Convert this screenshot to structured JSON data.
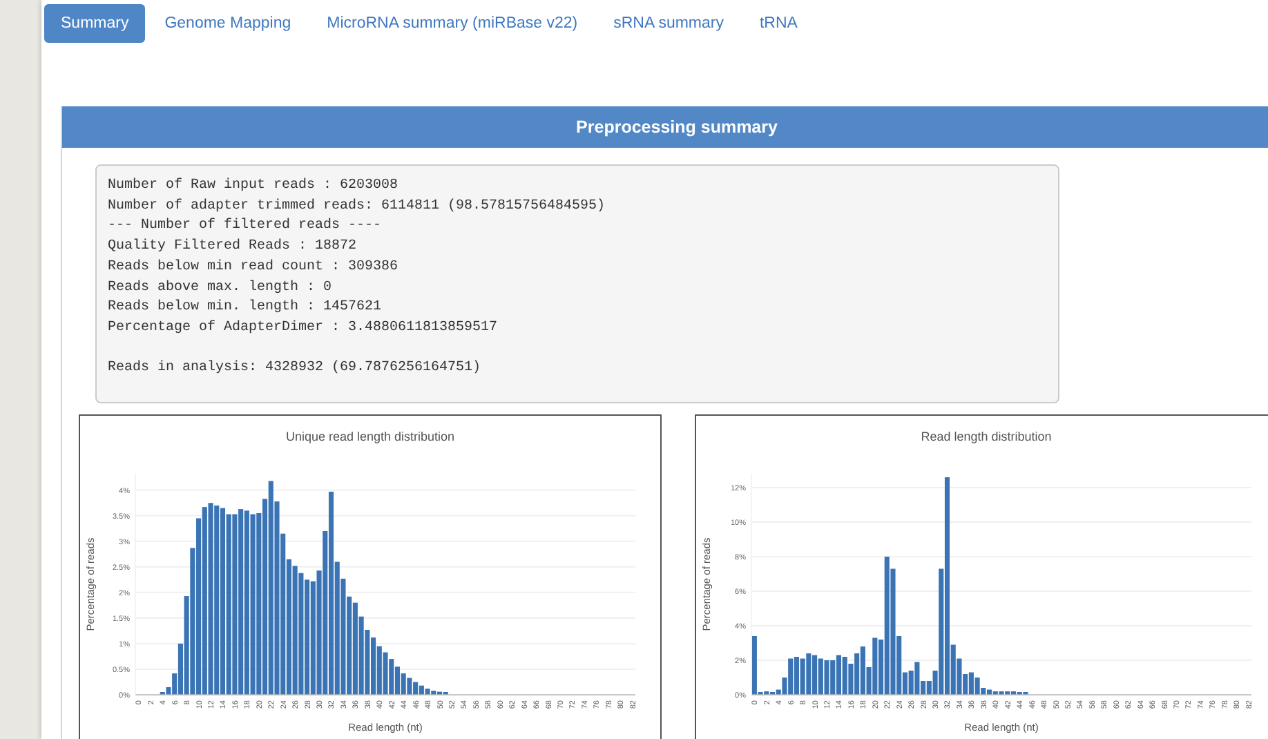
{
  "tabs": [
    {
      "label": "Summary",
      "selected": true
    },
    {
      "label": "Genome Mapping",
      "selected": false
    },
    {
      "label": "MicroRNA summary (miRBase v22)",
      "selected": false
    },
    {
      "label": "sRNA summary",
      "selected": false
    },
    {
      "label": "tRNA",
      "selected": false
    }
  ],
  "preprocessing": {
    "title": "Preprocessing summary",
    "lines": [
      "Number of Raw input reads : 6203008",
      "Number of adapter trimmed reads: 6114811 (98.57815756484595)",
      "--- Number of filtered reads ----",
      "Quality Filtered Reads : 18872",
      "Reads below min read count : 309386",
      "Reads above max. length : 0",
      "Reads below min. length : 1457621",
      "Percentage of AdapterDimer : 3.4880611813859517"
    ],
    "result": "Reads in analysis: 4328932 (69.7876256164751)"
  },
  "charts": [
    {
      "chart_data": {
        "type": "bar",
        "title": "Unique read length distribution",
        "xlabel": "Read length (nt)",
        "ylabel": "Percentage of reads",
        "x": [
          0,
          1,
          2,
          3,
          4,
          5,
          6,
          7,
          8,
          9,
          10,
          11,
          12,
          13,
          14,
          15,
          16,
          17,
          18,
          19,
          20,
          21,
          22,
          23,
          24,
          25,
          26,
          27,
          28,
          29,
          30,
          31,
          32,
          33,
          34,
          35,
          36,
          37,
          38,
          39,
          40,
          41,
          42,
          43,
          44,
          45,
          46,
          47,
          48,
          49,
          50,
          51,
          52,
          53,
          54,
          55,
          56,
          57,
          58,
          59,
          60,
          61,
          62,
          63,
          64,
          65,
          66,
          67,
          68,
          69,
          70,
          71,
          72,
          73,
          74,
          75,
          76,
          77,
          78,
          79,
          80,
          81,
          82
        ],
        "xlim": [
          -0.5,
          82.5
        ],
        "ylim": [
          0,
          4.32
        ],
        "grid": true,
        "values": [
          0,
          0,
          0,
          0,
          0.05,
          0.15,
          0.42,
          1.0,
          1.93,
          2.87,
          3.45,
          3.67,
          3.75,
          3.7,
          3.65,
          3.53,
          3.53,
          3.63,
          3.6,
          3.53,
          3.55,
          3.83,
          4.18,
          3.78,
          3.15,
          2.65,
          2.52,
          2.38,
          2.25,
          2.22,
          2.43,
          3.2,
          3.97,
          2.6,
          2.27,
          1.92,
          1.8,
          1.53,
          1.27,
          1.12,
          0.95,
          0.83,
          0.7,
          0.55,
          0.42,
          0.33,
          0.25,
          0.18,
          0.12,
          0.08,
          0.06,
          0.05,
          0,
          0,
          0,
          0,
          0,
          0,
          0,
          0,
          0,
          0,
          0,
          0,
          0,
          0,
          0,
          0,
          0,
          0,
          0,
          0,
          0,
          0,
          0,
          0,
          0,
          0,
          0,
          0,
          0,
          0,
          0
        ],
        "yticks": [
          {
            "value": 0,
            "label": "0%"
          },
          {
            "value": 0.5,
            "label": "0.5%"
          },
          {
            "value": 1,
            "label": "1%"
          },
          {
            "value": 1.5,
            "label": "1.5%"
          },
          {
            "value": 2,
            "label": "2%"
          },
          {
            "value": 2.5,
            "label": "2.5%"
          },
          {
            "value": 3,
            "label": "3%"
          },
          {
            "value": 3.5,
            "label": "3.5%"
          },
          {
            "value": 4,
            "label": "4%"
          }
        ],
        "xticks": [
          0,
          2,
          4,
          6,
          8,
          10,
          12,
          14,
          16,
          18,
          20,
          22,
          24,
          26,
          28,
          30,
          32,
          34,
          36,
          38,
          40,
          42,
          44,
          46,
          48,
          50,
          52,
          54,
          56,
          58,
          60,
          62,
          64,
          66,
          68,
          70,
          72,
          74,
          76,
          78,
          80,
          82
        ]
      }
    },
    {
      "chart_data": {
        "type": "bar",
        "title": "Read length distribution",
        "xlabel": "Read length (nt)",
        "ylabel": "Percentage of reads",
        "x": [
          0,
          1,
          2,
          3,
          4,
          5,
          6,
          7,
          8,
          9,
          10,
          11,
          12,
          13,
          14,
          15,
          16,
          17,
          18,
          19,
          20,
          21,
          22,
          23,
          24,
          25,
          26,
          27,
          28,
          29,
          30,
          31,
          32,
          33,
          34,
          35,
          36,
          37,
          38,
          39,
          40,
          41,
          42,
          43,
          44,
          45,
          46,
          47,
          48,
          49,
          50,
          51,
          52,
          53,
          54,
          55,
          56,
          57,
          58,
          59,
          60,
          61,
          62,
          63,
          64,
          65,
          66,
          67,
          68,
          69,
          70,
          71,
          72,
          73,
          74,
          75,
          76,
          77,
          78,
          79,
          80,
          81,
          82
        ],
        "xlim": [
          -0.5,
          82.5
        ],
        "ylim": [
          0,
          12.8
        ],
        "grid": true,
        "values": [
          3.4,
          0.1,
          0.2,
          0.1,
          0.3,
          1.0,
          2.1,
          2.2,
          2.1,
          2.4,
          2.3,
          2.1,
          2.0,
          2.0,
          2.3,
          2.2,
          1.8,
          2.4,
          2.8,
          1.6,
          3.3,
          3.2,
          8.0,
          7.3,
          3.4,
          1.3,
          1.4,
          1.9,
          0.8,
          0.8,
          1.4,
          7.3,
          12.6,
          2.9,
          2.1,
          1.2,
          1.3,
          1.0,
          0.4,
          0.3,
          0.2,
          0.2,
          0.2,
          0.2,
          0.1,
          0.1,
          0,
          0,
          0,
          0,
          0,
          0,
          0,
          0,
          0,
          0,
          0,
          0,
          0,
          0,
          0,
          0,
          0,
          0,
          0,
          0,
          0,
          0,
          0,
          0,
          0,
          0,
          0,
          0,
          0,
          0,
          0,
          0,
          0,
          0,
          0,
          0,
          0
        ],
        "yticks": [
          {
            "value": 0,
            "label": "0%"
          },
          {
            "value": 2,
            "label": "2%"
          },
          {
            "value": 4,
            "label": "4%"
          },
          {
            "value": 6,
            "label": "6%"
          },
          {
            "value": 8,
            "label": "8%"
          },
          {
            "value": 10,
            "label": "10%"
          },
          {
            "value": 12,
            "label": "12%"
          }
        ],
        "xticks": [
          0,
          2,
          4,
          6,
          8,
          10,
          12,
          14,
          16,
          18,
          20,
          22,
          24,
          26,
          28,
          30,
          32,
          34,
          36,
          38,
          40,
          42,
          44,
          46,
          48,
          50,
          52,
          54,
          56,
          58,
          60,
          62,
          64,
          66,
          68,
          70,
          72,
          74,
          76,
          78,
          80,
          82
        ]
      }
    }
  ]
}
